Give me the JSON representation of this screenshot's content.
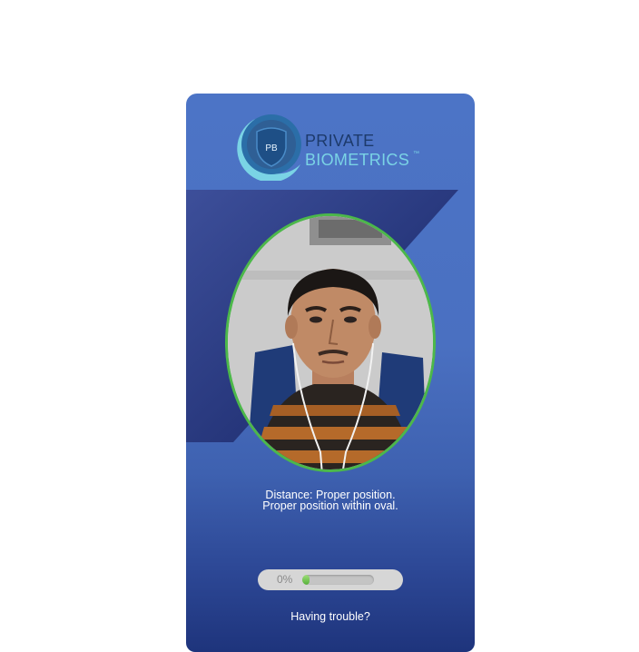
{
  "brand": {
    "logo_initials": "PB",
    "name_line_1": "PRIVATE",
    "name_line_2": "BIOMETRICS",
    "trademark": "™",
    "colors": {
      "dark_navy": "#1d3a6b",
      "light_teal": "#7ad3e5",
      "mid_blue": "#2f6aa6"
    }
  },
  "camera": {
    "guide_shape": "oval",
    "guide_color": "#4cb84a",
    "feed": "live-camera-feed-face"
  },
  "status": {
    "line_1": "Distance: Proper position.",
    "line_2": "Proper position within oval."
  },
  "progress": {
    "label": "0%",
    "value_fraction": 0.0,
    "fill_color": "#6cc24a"
  },
  "help": {
    "label": "Having trouble?"
  },
  "theme": {
    "card_top": "#4c74c6",
    "card_bottom": "#1e347c"
  }
}
